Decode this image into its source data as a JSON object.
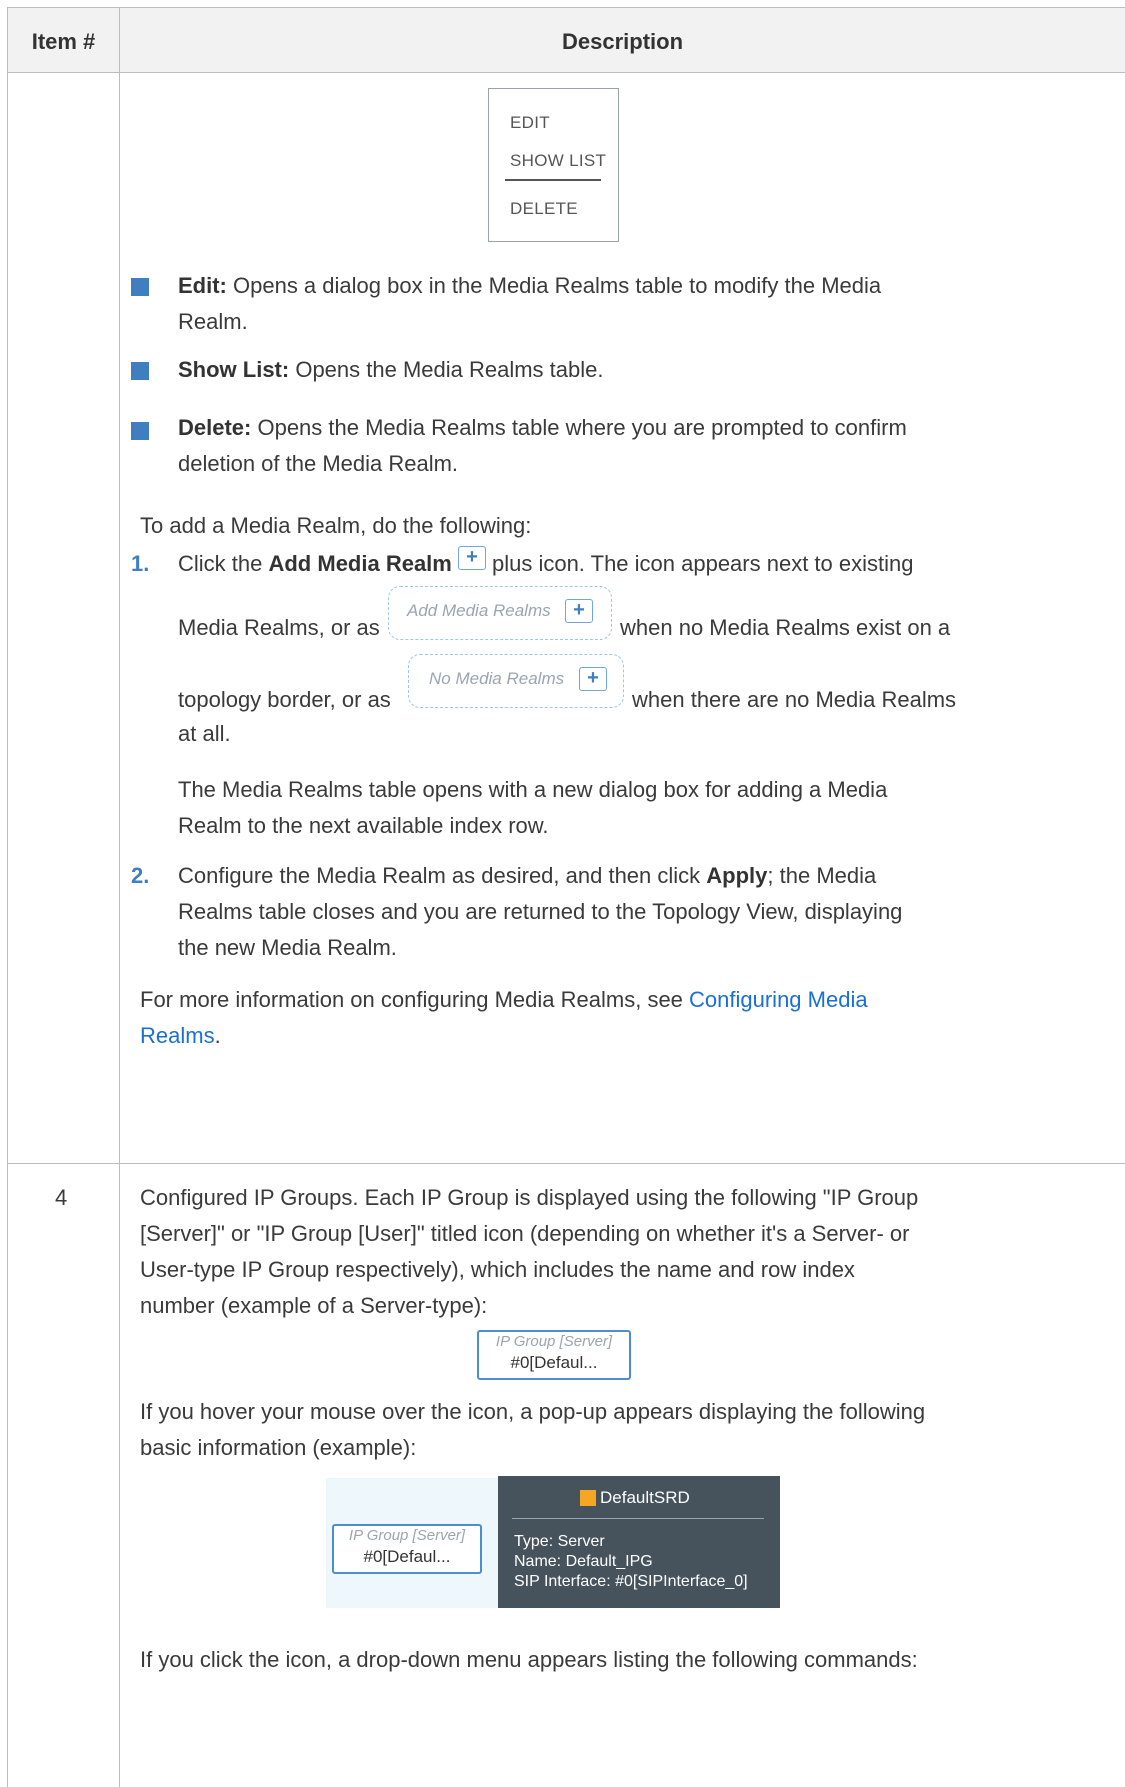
{
  "table": {
    "header": {
      "item_col": "Item #",
      "desc_col": "Description"
    }
  },
  "menu": {
    "items": [
      "EDIT",
      "SHOW LIST",
      "DELETE"
    ]
  },
  "bullets": [
    {
      "term": "Edit:",
      "line1": " Opens a dialog box in the Media Realms table to modify the Media",
      "line2": "Realm."
    },
    {
      "term": "Show List:",
      "line1": " Opens the Media Realms table.",
      "line2": ""
    },
    {
      "term": "Delete:",
      "line1": " Opens the Media Realms table where you are prompted to confirm",
      "line2": "deletion of the Media Realm."
    }
  ],
  "intro": "To add a Media Realm, do the following:",
  "steps": {
    "s1": {
      "num": "1.",
      "a": "Click the ",
      "b": "Add Media Realm",
      "c": " plus icon. The icon appears next to existing",
      "d": "Media Realms, or as",
      "e": "when no Media Realms exist on a",
      "f": "topology border, or as",
      "g": "when there are no Media Realms",
      "h": "at all.",
      "p1": "The Media Realms table opens with a new dialog box for adding a Media",
      "p2": "Realm to the next available index row."
    },
    "s2": {
      "num": "2.",
      "l1a": "Configure the Media Realm as desired, and then click ",
      "l1b": "Apply",
      "l1c": "; the Media",
      "l2": "Realms table closes and you are returned to the Topology View, displaying",
      "l3": "the new Media Realm."
    }
  },
  "more_info": {
    "prefix": "For more information on configuring Media Realms, see ",
    "link1": "Configuring Media",
    "link2": "Realms",
    "suffix": "."
  },
  "pills": {
    "add": "Add Media Realms",
    "none": "No Media Realms",
    "plus": "+"
  },
  "row4": {
    "item": "4",
    "p1": [
      "Configured IP Groups. Each IP Group is displayed using the following \"IP Group",
      "[Server]\" or \"IP Group [User]\" titled icon (depending on whether it's a Server- or",
      "User-type IP Group respectively), which includes the name and row index",
      "number (example of a Server-type):"
    ],
    "ipg_title": "IP Group [Server]",
    "ipg_name": "#0[Defaul...",
    "p2": [
      "If you hover your mouse over the icon, a pop-up appears displaying the following",
      "basic information (example):"
    ],
    "tooltip": {
      "srd": "DefaultSRD",
      "type": "Type: Server",
      "name": "Name: Default_IPG",
      "sip": "SIP Interface: #0[SIPInterface_0]"
    },
    "p3": "If you click the icon, a drop-down menu appears listing the following commands:"
  },
  "colors": {
    "bullet": "#3f7fc0",
    "link": "#1a6fd6",
    "tooltip_bg": "#46525c",
    "srd_square": "#f5a623",
    "rule": "#bdbdbd"
  }
}
